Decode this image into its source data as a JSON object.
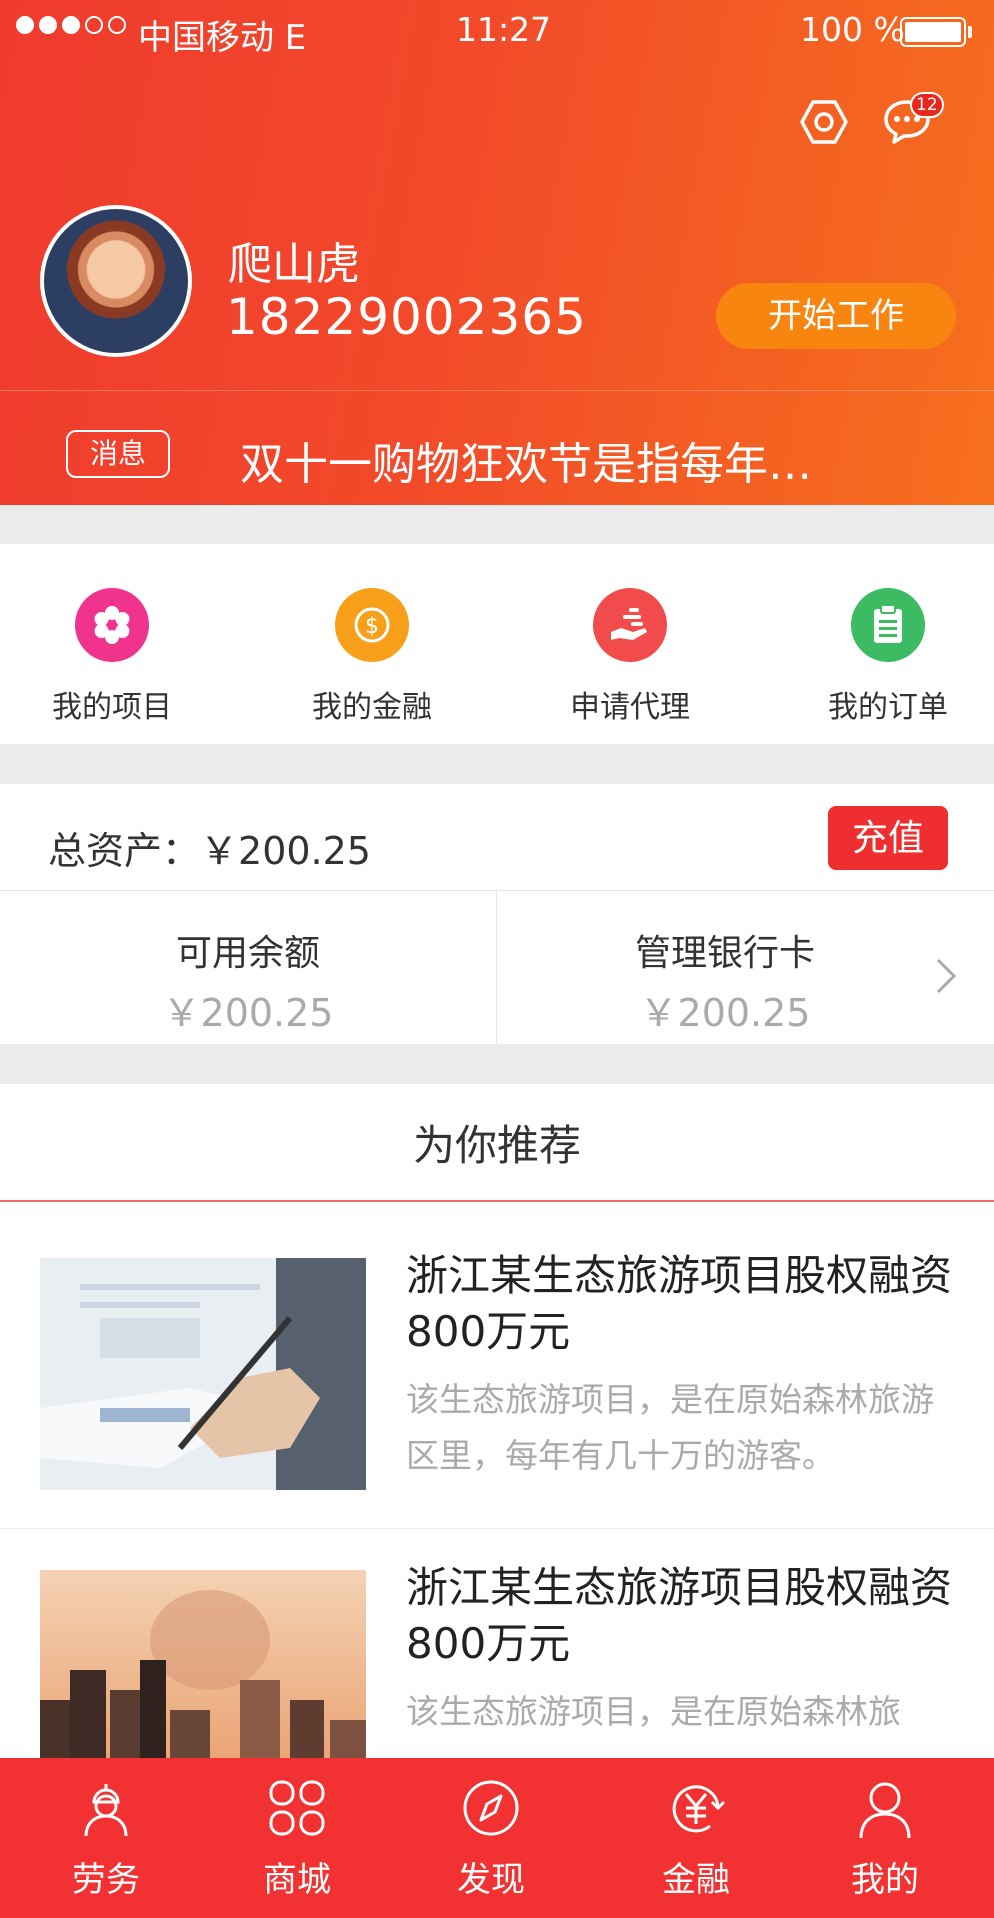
{
  "status_bar": {
    "carrier": "中国移动 E",
    "time": "11:27",
    "battery": "100 %"
  },
  "header": {
    "message_badge": "12",
    "user_name": "爬山虎",
    "user_phone": "18229002365",
    "start_work": "开始工作",
    "notice_label": "消息",
    "notice_text": "双十一购物狂欢节是指每年…"
  },
  "shortcuts": [
    {
      "label": "我的项目",
      "icon": "gear-icon",
      "color": "#f0348e"
    },
    {
      "label": "我的金融",
      "icon": "dollar-coin-icon",
      "color": "#f8a01a"
    },
    {
      "label": "申请代理",
      "icon": "hand-coins-icon",
      "color": "#f24b4b"
    },
    {
      "label": "我的订单",
      "icon": "clipboard-icon",
      "color": "#3dbb63"
    }
  ],
  "assets": {
    "total_label": "总资产：",
    "total_value": "￥200.25",
    "recharge": "充值",
    "available_title": "可用余额",
    "available_value": "￥200.25",
    "bank_title": "管理银行卡",
    "bank_value": "￥200.25"
  },
  "recommend": {
    "title": "为你推荐",
    "items": [
      {
        "title": "浙江某生态旅游项目股权融资800万元",
        "desc": "该生态旅游项目，是在原始森林旅游区里，每年有几十万的游客。"
      },
      {
        "title": "浙江某生态旅游项目股权融资800万元",
        "desc": "该生态旅游项目，是在原始森林旅"
      }
    ]
  },
  "tabbar": [
    {
      "label": "劳务",
      "icon": "worker-icon"
    },
    {
      "label": "商城",
      "icon": "grid-icon"
    },
    {
      "label": "发现",
      "icon": "compass-icon"
    },
    {
      "label": "金融",
      "icon": "yuan-refresh-icon"
    },
    {
      "label": "我的",
      "icon": "person-icon"
    }
  ]
}
